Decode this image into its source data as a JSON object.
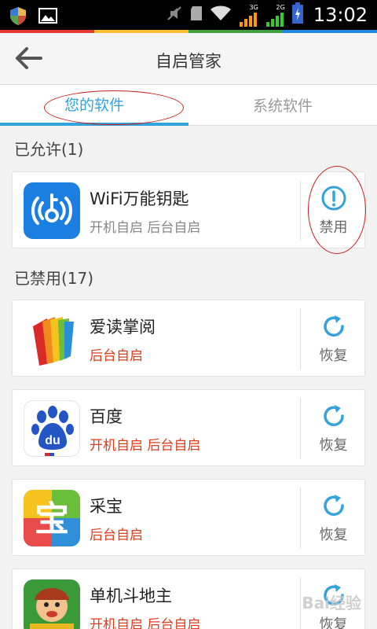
{
  "status_bar": {
    "time": "13:02",
    "network_3g": "3G",
    "network_2g": "2G",
    "colors": [
      "#e53935",
      "#fbc02d",
      "#43a047",
      "#1e88e5"
    ]
  },
  "app_bar": {
    "title": "自启管家"
  },
  "tabs": [
    {
      "label": "您的软件",
      "active": true
    },
    {
      "label": "系统软件",
      "active": false
    }
  ],
  "sections": {
    "allowed": {
      "title": "已允许(1)",
      "apps": [
        {
          "name": "WiFi万能钥匙",
          "desc": "开机自启 后台自启",
          "action": "禁用"
        }
      ]
    },
    "disabled": {
      "title": "已禁用(17)",
      "apps": [
        {
          "name": "爱读掌阅",
          "desc": "后台自启",
          "action": "恢复"
        },
        {
          "name": "百度",
          "desc": "开机自启 后台自启",
          "action": "恢复"
        },
        {
          "name": "采宝",
          "desc": "后台自启",
          "action": "恢复"
        },
        {
          "name": "单机斗地主",
          "desc": "开机自启 后台自启",
          "action": "恢复"
        }
      ]
    }
  },
  "icons": {
    "baidu_text": "du",
    "caibao_text": "宝"
  },
  "accent_color": "#33a3dc",
  "warning_color": "#e23b1b",
  "watermark": "Bai经验"
}
